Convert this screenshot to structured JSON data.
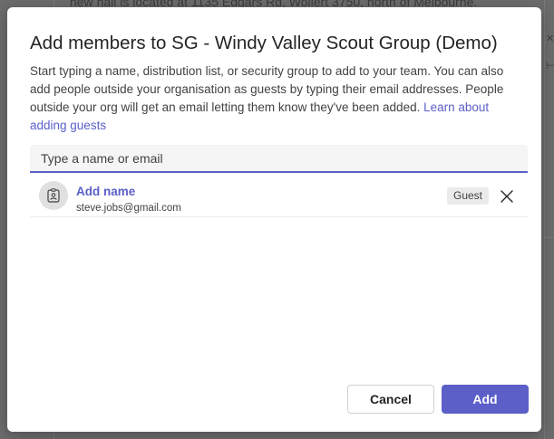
{
  "background": {
    "text": "new hall is located at 1135 Edgars Rd, Wollert 3750, north of Melbourne."
  },
  "dialog": {
    "title": "Add members to SG - Windy Valley Scout Group (Demo)",
    "description": "Start typing a name, distribution list, or security group to add to your team. You can also add people outside your organisation as guests by typing their email addresses. People outside your org will get an email letting them know they've been added. ",
    "learn_more_link": "Learn about adding guests",
    "search": {
      "placeholder": "Type a name or email",
      "value": ""
    },
    "members": [
      {
        "name": "Add name",
        "email": "steve.jobs@gmail.com",
        "badge": "Guest",
        "avatar_icon": "contact-card-icon",
        "remove_icon": "close-icon"
      }
    ],
    "buttons": {
      "cancel_label": "Cancel",
      "add_label": "Add"
    }
  },
  "colors": {
    "accent": "#5b5fc7",
    "overlay": "#6c6c6c",
    "badge_bg": "#ebebeb"
  }
}
